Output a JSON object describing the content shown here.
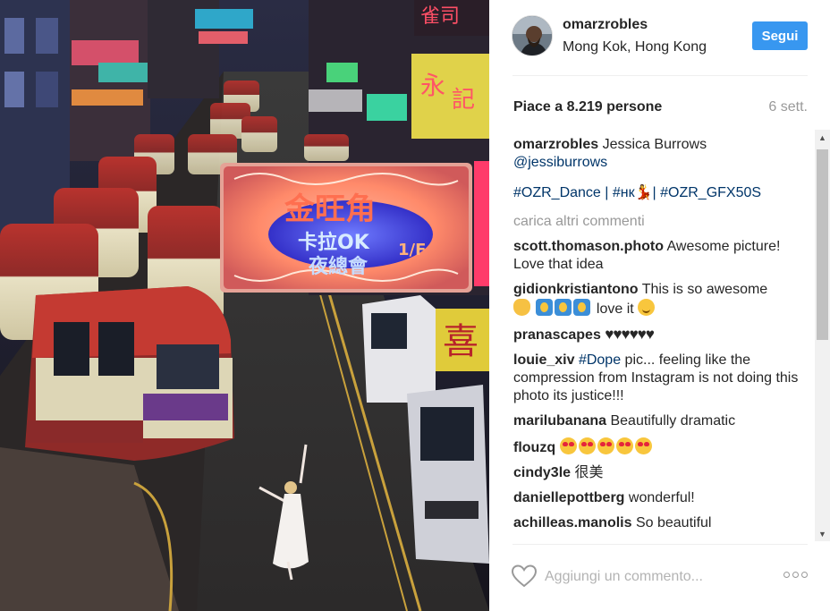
{
  "post": {
    "username": "omarzrobles",
    "location": "Mong Kok, Hong Kong",
    "follow_label": "Segui",
    "likes_text": "Piace a 8.219 persone",
    "date_text": "6 sett."
  },
  "caption": {
    "username": "omarzrobles",
    "text": "Jessica Burrows",
    "mention": "@jessiburrows",
    "hashtags": "#OZR_Dance | #нк💃| #OZR_GFX50S"
  },
  "load_more_label": "carica altri commenti",
  "comments": [
    {
      "user": "scott.thomason.photo",
      "text": "Awesome picture! Love that idea"
    },
    {
      "user": "gidionkristiantono",
      "text": "This is so awesome",
      "emoji_text": "love it"
    },
    {
      "user": "pranascapes",
      "text": "♥♥♥♥♥♥"
    },
    {
      "user": "louie_xiv",
      "hashtag": "#Dope",
      "text": "pic... feeling like the compression from Instagram is not doing this photo its justice!!!"
    },
    {
      "user": "marilubanana",
      "text": "Beautifully dramatic"
    },
    {
      "user": "flouzq",
      "text": ""
    },
    {
      "user": "cindy3le",
      "text": "很美"
    },
    {
      "user": "daniellepottberg",
      "text": "wonderful!"
    },
    {
      "user": "achilleas.manolis",
      "text": "So beautiful"
    }
  ],
  "footer": {
    "comment_placeholder": "Aggiungi un commento...",
    "more_icon": "more-options-icon"
  },
  "photo": {
    "sign_top": "金旺角",
    "sign_mid": "卡拉OK",
    "sign_bottom": "夜總會",
    "sign_side": "1/F",
    "sign_right": "喜",
    "sign_corner": "雀司"
  },
  "colors": {
    "follow_bg": "#3897f0",
    "link": "#003569",
    "muted": "#999999"
  }
}
